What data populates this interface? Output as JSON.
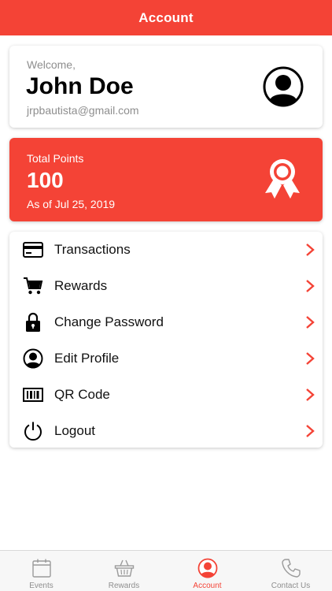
{
  "header": {
    "title": "Account"
  },
  "profile": {
    "welcome": "Welcome,",
    "name": "John Doe",
    "email": "jrpbautista@gmail.com"
  },
  "points": {
    "label": "Total Points",
    "value": "100",
    "as_of": "As of Jul 25, 2019"
  },
  "menu": {
    "items": [
      {
        "label": "Transactions",
        "icon": "credit-card-icon"
      },
      {
        "label": "Rewards",
        "icon": "shopping-cart-icon"
      },
      {
        "label": "Change Password",
        "icon": "lock-icon"
      },
      {
        "label": "Edit Profile",
        "icon": "user-circle-icon"
      },
      {
        "label": "QR Code",
        "icon": "barcode-icon"
      },
      {
        "label": "Logout",
        "icon": "power-icon"
      }
    ]
  },
  "tabs": [
    {
      "label": "Events",
      "icon": "calendar-icon",
      "active": false
    },
    {
      "label": "Rewards",
      "icon": "basket-icon",
      "active": false
    },
    {
      "label": "Account",
      "icon": "user-circle-icon",
      "active": true
    },
    {
      "label": "Contact Us",
      "icon": "phone-icon",
      "active": false
    }
  ],
  "colors": {
    "accent": "#f44336",
    "muted_text": "#8e8e8e",
    "tabbar_bg": "#f7f7f7"
  }
}
